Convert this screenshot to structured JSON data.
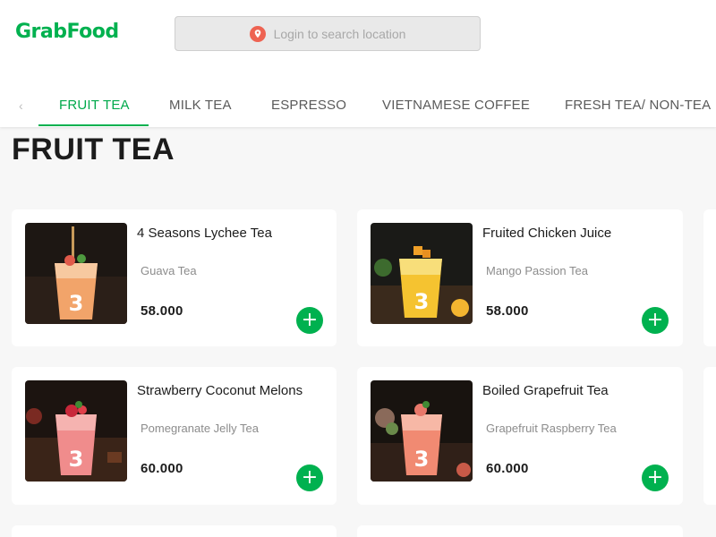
{
  "brand": {
    "logo_text": "GrabFood",
    "color": "#00b14f"
  },
  "search": {
    "placeholder": "Login to search location",
    "icon": "location-pin-icon"
  },
  "tabs": [
    {
      "label": "FRUIT TEA",
      "active": true
    },
    {
      "label": "MILK TEA",
      "active": false
    },
    {
      "label": "ESPRESSO",
      "active": false
    },
    {
      "label": "VIETNAMESE COFFEE",
      "active": false
    },
    {
      "label": "FRESH TEA/ NON-TEA",
      "active": false
    }
  ],
  "section": {
    "title": "FRUIT TEA"
  },
  "items": [
    {
      "name": "4 Seasons Lychee Tea",
      "desc": "Guava Tea",
      "price": "58.000"
    },
    {
      "name": "Fruited Chicken Juice",
      "desc": "Mango Passion Tea",
      "price": "58.000"
    },
    {
      "name": "Strawberry Coconut Melons",
      "desc": "Pomegranate Jelly Tea",
      "price": "60.000"
    },
    {
      "name": "Boiled Grapefruit Tea",
      "desc": "Grapefruit Raspberry Tea",
      "price": "60.000"
    }
  ],
  "add_button_label": "+"
}
